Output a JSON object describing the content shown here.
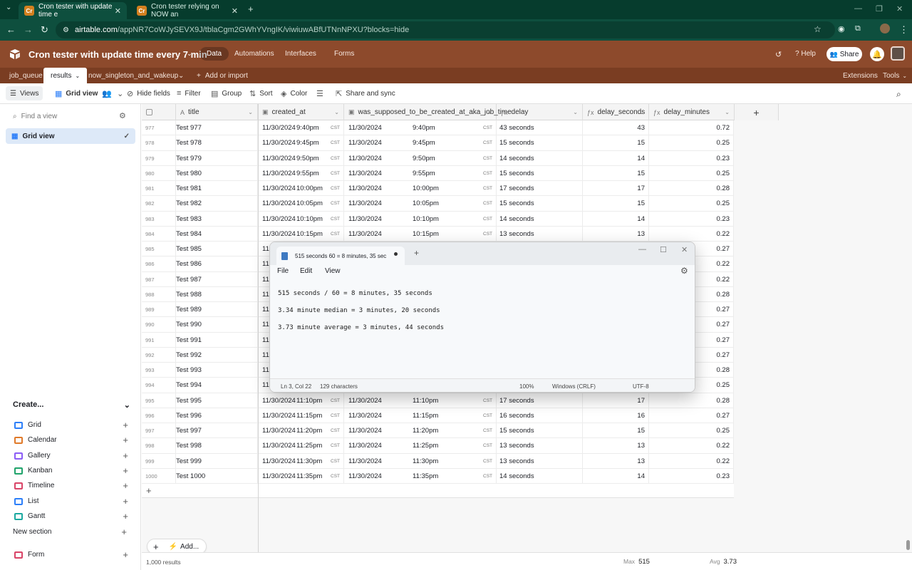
{
  "browser": {
    "tabs": [
      {
        "favicon": "Cr",
        "title": "Cron tester with update time e",
        "active": true
      },
      {
        "favicon": "Cr",
        "title": "Cron tester relying on NOW an",
        "active": false
      }
    ],
    "url_host": "airtable.com",
    "url_path": "/appNR7CoWJySEVX9J/tblaCgm2GWhYVngIK/viwiuwABfUTNnNPXU?blocks=hide"
  },
  "app": {
    "base_name": "Cron tester with update time every 7 min",
    "nav": [
      "Data",
      "Automations",
      "Interfaces",
      "Forms"
    ],
    "help": "Help",
    "share": "Share",
    "tables": [
      "job_queue",
      "results",
      "now_singleton_and_wakeup"
    ],
    "add_or_import": "Add or import",
    "extensions": "Extensions",
    "tools": "Tools"
  },
  "toolbar": {
    "views": "Views",
    "grid_view": "Grid view",
    "hide_fields": "Hide fields",
    "filter": "Filter",
    "group": "Group",
    "sort": "Sort",
    "color": "Color",
    "share_sync": "Share and sync"
  },
  "sidebar": {
    "find_placeholder": "Find a view",
    "current_view": "Grid view",
    "create": "Create...",
    "create_items": [
      {
        "label": "Grid",
        "color": "#2d7ff9"
      },
      {
        "label": "Calendar",
        "color": "#e07a2a"
      },
      {
        "label": "Gallery",
        "color": "#8b5cf6"
      },
      {
        "label": "Kanban",
        "color": "#20a36b"
      },
      {
        "label": "Timeline",
        "color": "#d94467"
      },
      {
        "label": "List",
        "color": "#2d7ff9"
      },
      {
        "label": "Gantt",
        "color": "#1ba9a0"
      }
    ],
    "new_section": "New section",
    "form": {
      "label": "Form",
      "color": "#d94467"
    }
  },
  "grid": {
    "columns": [
      "title",
      "created_at",
      "was_supposed_to_be_created_at_aka_job_time",
      "delay",
      "delay_seconds",
      "delay_minutes"
    ],
    "tz": "CST",
    "rows": [
      {
        "n": "977",
        "title": "Test 977",
        "created_date": "11/30/2024",
        "created_time": "9:40pm",
        "job_date": "11/30/2024",
        "job_time": "9:40pm",
        "delay": "43 seconds",
        "ds": "43",
        "dm": "0.72"
      },
      {
        "n": "978",
        "title": "Test 978",
        "created_date": "11/30/2024",
        "created_time": "9:45pm",
        "job_date": "11/30/2024",
        "job_time": "9:45pm",
        "delay": "15 seconds",
        "ds": "15",
        "dm": "0.25"
      },
      {
        "n": "979",
        "title": "Test 979",
        "created_date": "11/30/2024",
        "created_time": "9:50pm",
        "job_date": "11/30/2024",
        "job_time": "9:50pm",
        "delay": "14 seconds",
        "ds": "14",
        "dm": "0.23"
      },
      {
        "n": "980",
        "title": "Test 980",
        "created_date": "11/30/2024",
        "created_time": "9:55pm",
        "job_date": "11/30/2024",
        "job_time": "9:55pm",
        "delay": "15 seconds",
        "ds": "15",
        "dm": "0.25"
      },
      {
        "n": "981",
        "title": "Test 981",
        "created_date": "11/30/2024",
        "created_time": "10:00pm",
        "job_date": "11/30/2024",
        "job_time": "10:00pm",
        "delay": "17 seconds",
        "ds": "17",
        "dm": "0.28"
      },
      {
        "n": "982",
        "title": "Test 982",
        "created_date": "11/30/2024",
        "created_time": "10:05pm",
        "job_date": "11/30/2024",
        "job_time": "10:05pm",
        "delay": "15 seconds",
        "ds": "15",
        "dm": "0.25"
      },
      {
        "n": "983",
        "title": "Test 983",
        "created_date": "11/30/2024",
        "created_time": "10:10pm",
        "job_date": "11/30/2024",
        "job_time": "10:10pm",
        "delay": "14 seconds",
        "ds": "14",
        "dm": "0.23"
      },
      {
        "n": "984",
        "title": "Test 984",
        "created_date": "11/30/2024",
        "created_time": "10:15pm",
        "job_date": "11/30/2024",
        "job_time": "10:15pm",
        "delay": "13 seconds",
        "ds": "13",
        "dm": "0.22"
      },
      {
        "n": "985",
        "title": "Test 985",
        "created_date": "11/",
        "created_time": "",
        "job_date": "",
        "job_time": "",
        "delay": "",
        "ds": "",
        "dm": "0.27"
      },
      {
        "n": "986",
        "title": "Test 986",
        "created_date": "11/",
        "created_time": "",
        "job_date": "",
        "job_time": "",
        "delay": "",
        "ds": "",
        "dm": "0.22"
      },
      {
        "n": "987",
        "title": "Test 987",
        "created_date": "11/",
        "created_time": "",
        "job_date": "",
        "job_time": "",
        "delay": "",
        "ds": "",
        "dm": "0.22"
      },
      {
        "n": "988",
        "title": "Test 988",
        "created_date": "11/",
        "created_time": "",
        "job_date": "",
        "job_time": "",
        "delay": "",
        "ds": "",
        "dm": "0.28"
      },
      {
        "n": "989",
        "title": "Test 989",
        "created_date": "11/",
        "created_time": "",
        "job_date": "",
        "job_time": "",
        "delay": "",
        "ds": "",
        "dm": "0.27"
      },
      {
        "n": "990",
        "title": "Test 990",
        "created_date": "11/",
        "created_time": "",
        "job_date": "",
        "job_time": "",
        "delay": "",
        "ds": "",
        "dm": "0.27"
      },
      {
        "n": "991",
        "title": "Test 991",
        "created_date": "11/",
        "created_time": "",
        "job_date": "",
        "job_time": "",
        "delay": "",
        "ds": "",
        "dm": "0.27"
      },
      {
        "n": "992",
        "title": "Test 992",
        "created_date": "11/",
        "created_time": "",
        "job_date": "",
        "job_time": "",
        "delay": "",
        "ds": "",
        "dm": "0.27"
      },
      {
        "n": "993",
        "title": "Test 993",
        "created_date": "11/",
        "created_time": "",
        "job_date": "",
        "job_time": "",
        "delay": "",
        "ds": "",
        "dm": "0.28"
      },
      {
        "n": "994",
        "title": "Test 994",
        "created_date": "11/",
        "created_time": "",
        "job_date": "",
        "job_time": "",
        "delay": "",
        "ds": "",
        "dm": "0.25"
      },
      {
        "n": "995",
        "title": "Test 995",
        "created_date": "11/30/2024",
        "created_time": "11:10pm",
        "job_date": "11/30/2024",
        "job_time": "11:10pm",
        "delay": "17 seconds",
        "ds": "17",
        "dm": "0.28"
      },
      {
        "n": "996",
        "title": "Test 996",
        "created_date": "11/30/2024",
        "created_time": "11:15pm",
        "job_date": "11/30/2024",
        "job_time": "11:15pm",
        "delay": "16 seconds",
        "ds": "16",
        "dm": "0.27"
      },
      {
        "n": "997",
        "title": "Test 997",
        "created_date": "11/30/2024",
        "created_time": "11:20pm",
        "job_date": "11/30/2024",
        "job_time": "11:20pm",
        "delay": "15 seconds",
        "ds": "15",
        "dm": "0.25"
      },
      {
        "n": "998",
        "title": "Test 998",
        "created_date": "11/30/2024",
        "created_time": "11:25pm",
        "job_date": "11/30/2024",
        "job_time": "11:25pm",
        "delay": "13 seconds",
        "ds": "13",
        "dm": "0.22"
      },
      {
        "n": "999",
        "title": "Test 999",
        "created_date": "11/30/2024",
        "created_time": "11:30pm",
        "job_date": "11/30/2024",
        "job_time": "11:30pm",
        "delay": "13 seconds",
        "ds": "13",
        "dm": "0.22"
      },
      {
        "n": "1000",
        "title": "Test 1000",
        "created_date": "11/30/2024",
        "created_time": "11:35pm",
        "job_date": "11/30/2024",
        "job_time": "11:35pm",
        "delay": "14 seconds",
        "ds": "14",
        "dm": "0.23"
      }
    ],
    "add_label": "Add...",
    "record_count": "1,000 results",
    "max_label": "Max",
    "max_value": "515",
    "avg_label": "Avg",
    "avg_value": "3.73"
  },
  "notepad": {
    "tab_title": "515 seconds  60 = 8 minutes, 35 sec",
    "menu": [
      "File",
      "Edit",
      "View"
    ],
    "lines": [
      "515 seconds / 60 = 8 minutes, 35 seconds",
      "3.34 minute median = 3 minutes, 20 seconds",
      "3.73 minute average = 3 minutes, 44 seconds"
    ],
    "status": {
      "position": "Ln 3, Col 22",
      "chars": "129 characters",
      "zoom": "100%",
      "eol": "Windows (CRLF)",
      "encoding": "UTF-8"
    }
  }
}
